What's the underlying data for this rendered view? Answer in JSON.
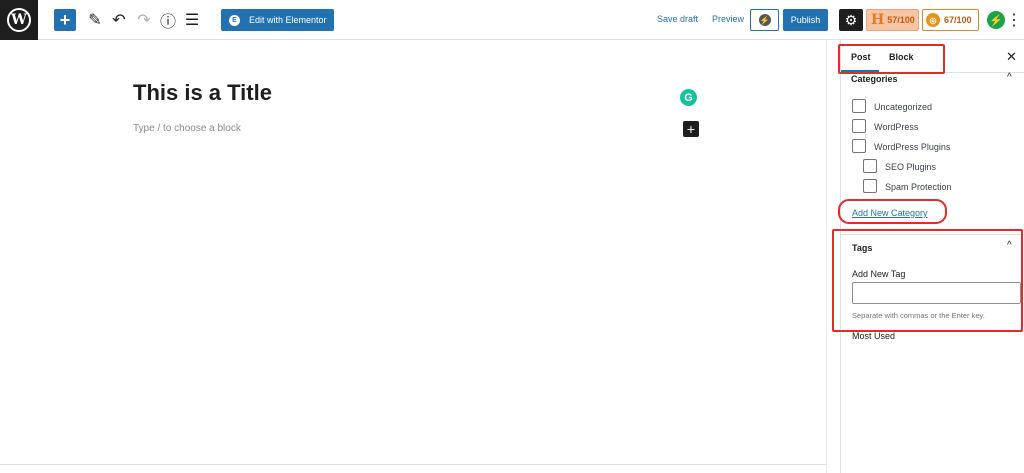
{
  "toolbar": {
    "logo": "W",
    "add_icon": "+",
    "edit_icon": "✎",
    "undo_icon": "↶",
    "redo_icon": "↷",
    "info_icon": "ⓘ",
    "list_icon": "☰",
    "elementor_badge": "E",
    "elementor_label": "Edit with Elementor",
    "save_draft": "Save draft",
    "preview": "Preview",
    "jetpack_icon": "⚡",
    "publish": "Publish",
    "settings_icon": "⚙",
    "headline_score_letter": "H",
    "headline_score": "57/100",
    "seo_score_icon": "◎",
    "seo_score": "67/100",
    "performance_icon": "⚡",
    "more_icon": "⋮"
  },
  "editor": {
    "title": "This is a Title",
    "block_placeholder": "Type / to choose a block",
    "grammarly_icon": "G",
    "add_block_icon": "+"
  },
  "sidebar": {
    "tabs": [
      {
        "label": "Post",
        "active": true
      },
      {
        "label": "Block",
        "active": false
      }
    ],
    "close_icon": "✕",
    "categories": {
      "title": "Categories",
      "chevron": "^",
      "items": [
        {
          "label": "Uncategorized",
          "checked": false,
          "level": 0
        },
        {
          "label": "WordPress",
          "checked": false,
          "level": 0
        },
        {
          "label": "WordPress Plugins",
          "checked": false,
          "level": 0
        },
        {
          "label": "SEO Plugins",
          "checked": false,
          "level": 1
        },
        {
          "label": "Spam Protection",
          "checked": false,
          "level": 1
        }
      ],
      "add_new_link": "Add New Category"
    },
    "tags": {
      "title": "Tags",
      "chevron": "^",
      "add_label": "Add New Tag",
      "input_value": "",
      "help": "Separate with commas or the Enter key.",
      "most_used": "Most Used"
    }
  },
  "colors": {
    "accent": "#2271b1",
    "dark": "#1e1e1e",
    "annotation": "#e32b2b",
    "headline_score_bg": "#f7c4a4",
    "seo_score_border": "#e08a20",
    "grammarly": "#15c39a",
    "performance": "#1aa34a"
  }
}
